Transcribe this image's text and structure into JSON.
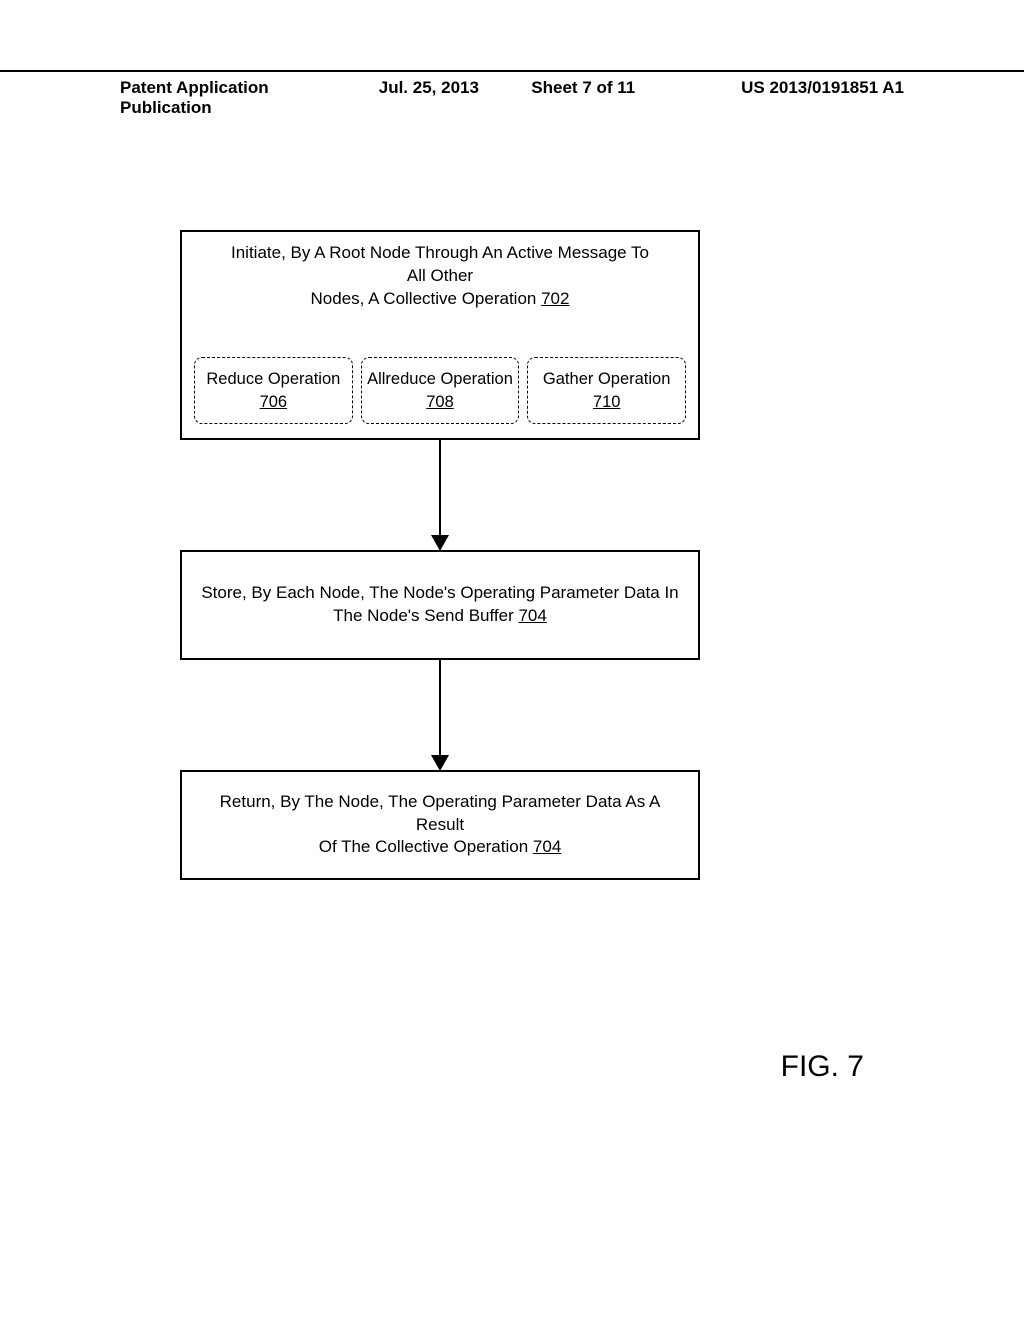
{
  "header": {
    "publication": "Patent Application Publication",
    "date": "Jul. 25, 2013",
    "sheet": "Sheet 7 of 11",
    "pubno": "US 2013/0191851 A1"
  },
  "box702": {
    "text_a": "Initiate, By A Root Node Through An Active Message To All Other",
    "text_b": "Nodes, A Collective Operation ",
    "ref": "702",
    "reduce_label": "Reduce Operation",
    "reduce_ref": "706",
    "allreduce_label": "Allreduce Operation",
    "allreduce_ref": "708",
    "gather_label": "Gather Operation",
    "gather_ref": "710"
  },
  "box704a": {
    "text_a": "Store, By Each Node, The Node's Operating Parameter Data In",
    "text_b": "The Node's Send Buffer ",
    "ref": "704"
  },
  "box704b": {
    "text_a": "Return, By The Node, The Operating Parameter Data As A Result",
    "text_b": "Of The Collective Operation ",
    "ref": "704"
  },
  "figure_label": "FIG. 7"
}
